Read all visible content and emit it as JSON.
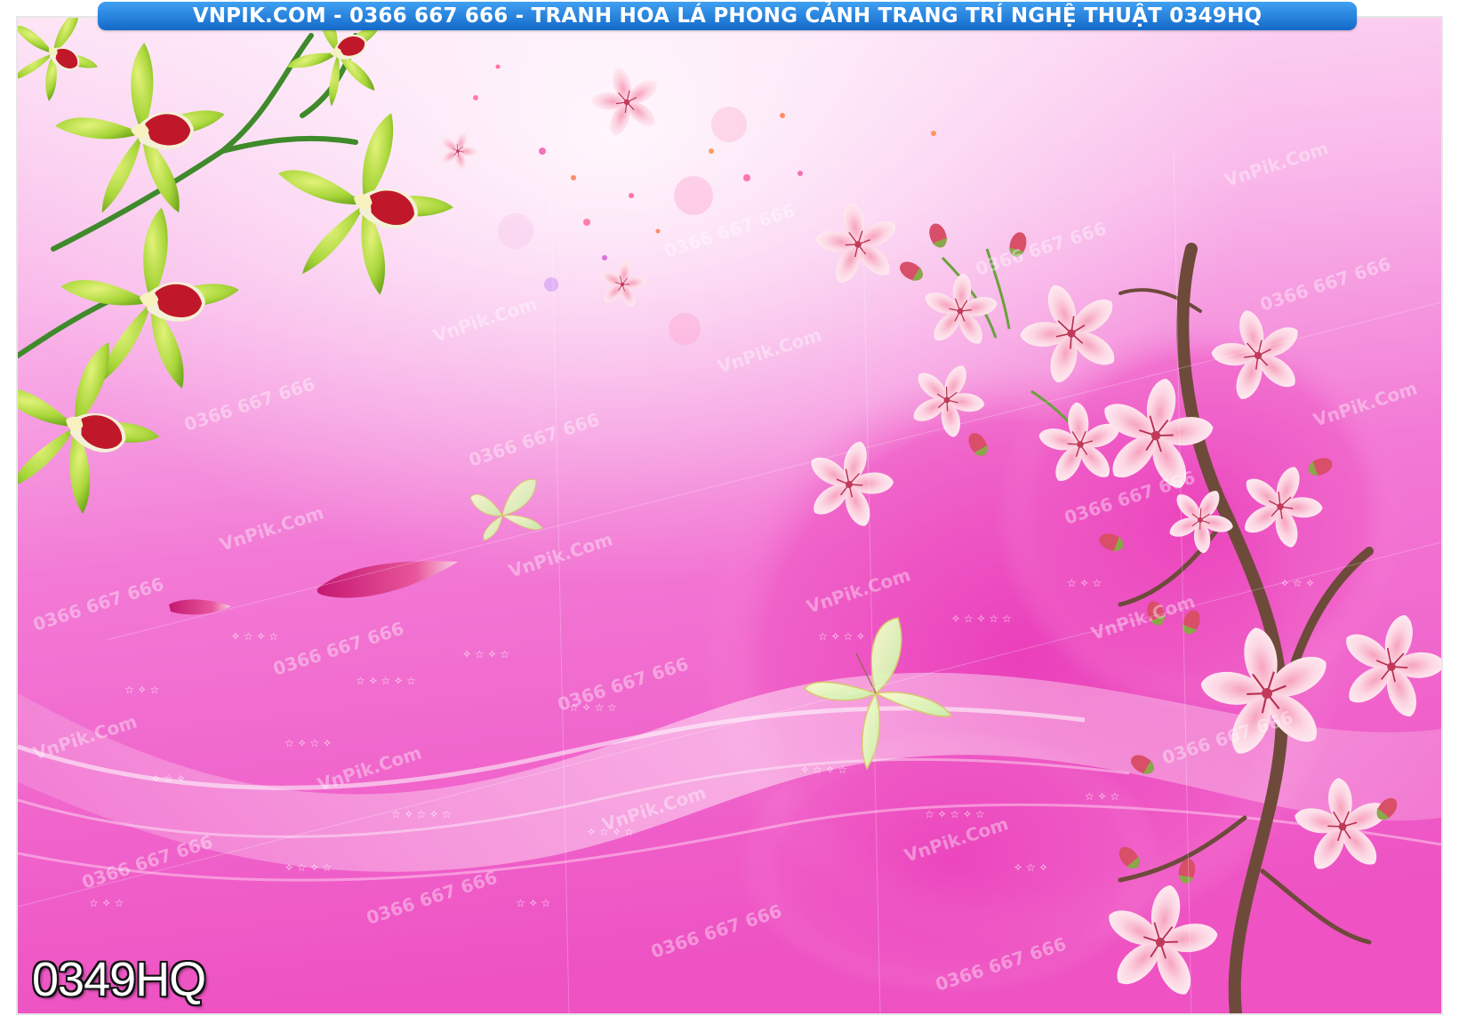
{
  "banner": {
    "text": "VNPIK.COM - 0366 667 666 - TRANH HOA LÁ PHONG CẢNH TRANG TRÍ NGHỆ THUẬT 0349HQ"
  },
  "code_label": "0349HQ",
  "watermarks": {
    "brand": "VnPik.Com",
    "phone": "0366 667 666"
  },
  "colors": {
    "banner_blue": "#1f7fe0",
    "background_pink": "#f257c6",
    "light_pink": "#fbd0ee",
    "orchid_green": "#a9d63a",
    "orchid_red": "#c0182a",
    "blossom_pink": "#fbd3df"
  }
}
